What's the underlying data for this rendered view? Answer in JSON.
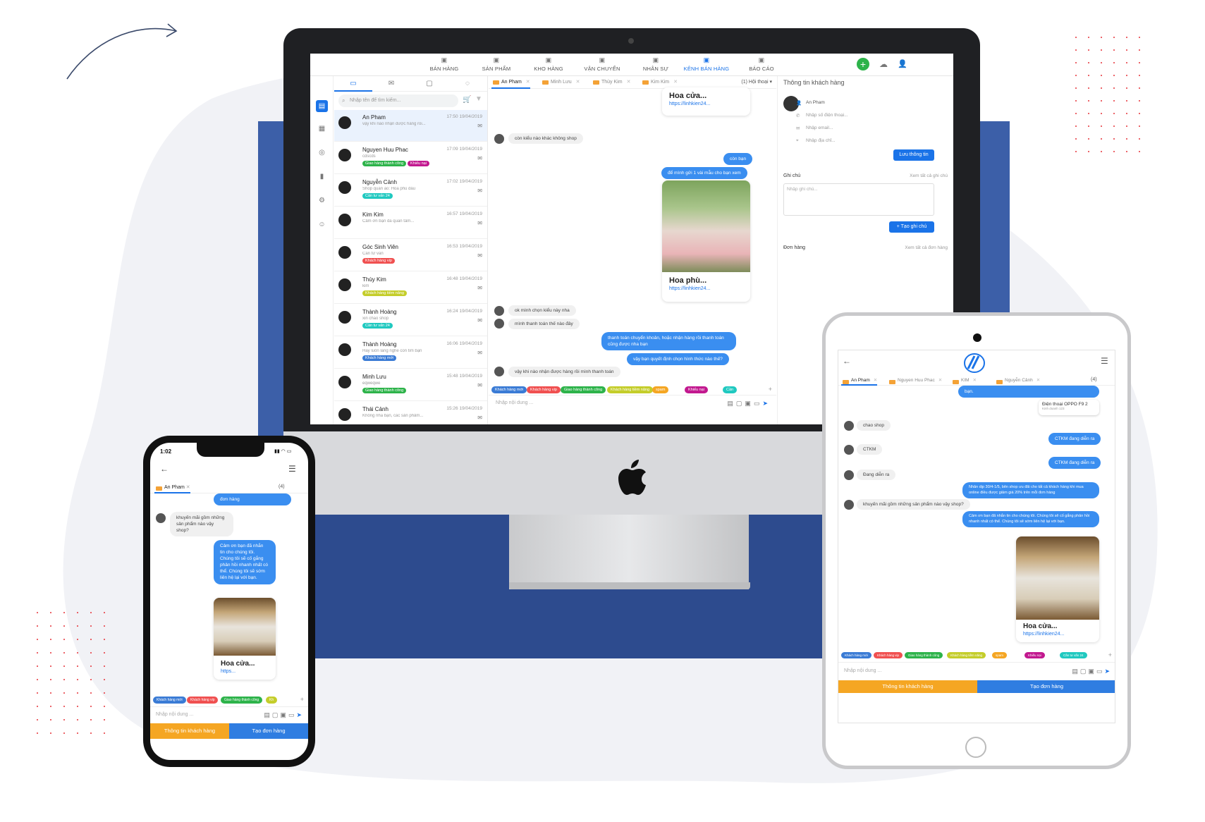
{
  "nav": {
    "items": [
      {
        "label": "BÁN HÀNG",
        "icon": "basket-icon"
      },
      {
        "label": "SẢN PHẨM",
        "icon": "store-icon"
      },
      {
        "label": "KHO HÀNG",
        "icon": "warehouse-icon"
      },
      {
        "label": "VẬN CHUYỂN",
        "icon": "truck-icon"
      },
      {
        "label": "NHÂN SỰ",
        "icon": "id-card-icon"
      },
      {
        "label": "KÊNH BÁN HÀNG",
        "icon": "globe-icon",
        "active": true
      },
      {
        "label": "BÁO CÁO",
        "icon": "report-icon"
      }
    ]
  },
  "search": {
    "placeholder": "Nhập tên để tìm kiếm..."
  },
  "conversations": [
    {
      "name": "An Pham",
      "time": "17:50 19/04/2019",
      "preview": "vậy khi nào nhận được hàng rồi...",
      "tag": "",
      "tag_color": ""
    },
    {
      "name": "Nguyen Huu Phac",
      "time": "17:09 19/04/2019",
      "preview": "cdscds",
      "tag": "Giao hàng thành công",
      "tag_color": "#2db34a",
      "tag2": "Khiếu nại"
    },
    {
      "name": "Nguyễn Cảnh",
      "time": "17:02 19/04/2019",
      "preview": "Shop quần áo: Hoa phù dâu",
      "tag": "Cần tư vấn 24",
      "tag_color": "#20c9c0"
    },
    {
      "name": "Kim Kim",
      "time": "16:57 19/04/2019",
      "preview": "Cảm ơn bạn đã quan tâm...",
      "tag": "",
      "tag_color": ""
    },
    {
      "name": "Góc Sinh Viên",
      "time": "16:53 19/04/2019",
      "preview": "Cần tư vấn",
      "tag": "Khách hàng vip",
      "tag_color": "#f05050"
    },
    {
      "name": "Thùy Kim",
      "time": "16:48 19/04/2019",
      "preview": "kim",
      "tag": "Khách hàng tiềm năng",
      "tag_color": "#c4cd2a"
    },
    {
      "name": "Thành Hoàng",
      "time": "16:24 19/04/2019",
      "preview": "xin chao shop",
      "tag": "Cần tư vấn 24",
      "tag_color": "#20c9c0"
    },
    {
      "name": "Thành Hoàng",
      "time": "16:06 19/04/2019",
      "preview": "Hãy luôn lắng nghe con tim bạn",
      "tag": "Khách hàng mới",
      "tag_color": "#3a7bd5"
    },
    {
      "name": "Minh Lưu",
      "time": "15:48 19/04/2019",
      "preview": "eqweqwe",
      "tag": "Giao hàng thành công",
      "tag_color": "#2db34a"
    },
    {
      "name": "Thái Cảnh",
      "time": "15:26 19/04/2019",
      "preview": "Không nha bạn, các sản phẩm...",
      "tag": "",
      "tag_color": ""
    }
  ],
  "chat_tabs": [
    "An Pham",
    "Minh Lưu",
    "Thùy Kim",
    "Kim Kim"
  ],
  "chat_tab_count": "(1) Hội thoại",
  "messages": {
    "card1_title": "Hoa cửa...",
    "card1_link": "https://linhkien24...",
    "m1": "còn kiểu nào khác không shop",
    "m2": "còn bạn",
    "m3": "để mình gửi 1 vài mẫu cho bạn xem",
    "card2_title": "Hoa phù...",
    "card2_link": "https://linhkien24...",
    "m4": "ok mình chọn kiểu này nha",
    "m5": "mình thanh toán thế nào đây",
    "m6": "thanh toán chuyển khoản, hoặc nhận hàng rồi thanh toán cũng được nha bạn",
    "m7": "vậy bạn quyết định chọn hình thức nào thế?",
    "m8": "vậy khi nào nhận được hàng rồi mình thanh toán"
  },
  "quick_tags": [
    {
      "label": "Khách hàng mới",
      "color": "#3a7bd5"
    },
    {
      "label": "Khách hàng vip",
      "color": "#f05050"
    },
    {
      "label": "Giao hàng thành công",
      "color": "#2db34a"
    },
    {
      "label": "Khách hàng tiềm năng",
      "color": "#c4cd2a"
    },
    {
      "label": "spam",
      "color": "#f5a623"
    },
    {
      "label": "Khiếu nại",
      "color": "#c2188f"
    },
    {
      "label": "Cần",
      "color": "#20c9c0"
    }
  ],
  "input_placeholder": "Nhập nội dung ...",
  "info": {
    "title": "Thông tin khách hàng",
    "name": "An Pham",
    "phone": "Nhập số điện thoại...",
    "email": "Nhập email...",
    "address": "Nhập địa chỉ...",
    "save": "Lưu thông tin",
    "note_title": "Ghi chú",
    "note_link": "Xem tất cả ghi chú",
    "note_placeholder": "Nhập ghi chú...",
    "note_btn": "+ Tạo ghi chú",
    "order_title": "Đơn hàng",
    "order_link": "Xem tất cả đơn hàng"
  },
  "phone": {
    "time": "1:02",
    "tab": "An Pham",
    "count": "(4)",
    "m0": "đơn hàng",
    "m1": "khuyến mãi gồm những sản phẩm nào vậy shop?",
    "m2": "Cảm ơn bạn đã nhắn tin cho chúng tôi. Chúng tôi sẽ cố gắng phản hồi nhanh nhất có thể. Chúng tôi sẽ sớm liên hệ lại với bạn.",
    "card_title": "Hoa cửa...",
    "card_link": "https...",
    "tags": [
      "Khách hàng mới",
      "Khách hàng vip",
      "Giao hàng thành công",
      "Kh"
    ],
    "input": "Nhập nội dung ...",
    "btn_info": "Thông tin khách hàng",
    "btn_order": "Tạo đơn hàng"
  },
  "tablet": {
    "tabs": [
      "An Pham",
      "Nguyen Huu Phac",
      "KIM",
      "Nguyễn Cảnh"
    ],
    "count": "(4)",
    "m0": "bạn.",
    "product": "Điện thoại OPPO F9 2",
    "product_sub": "Kinh doanh 123",
    "m1": "chao shop",
    "m2": "CTKM đang diễn ra",
    "m3": "CTKM",
    "m4": "CTKM đang diễn ra",
    "m5": "Đang diễn ra",
    "m6": "Nhân dịp 30/4-1/5, bên shop ưu đãi cho tất cả khách hàng khi mua online điều được giảm giá 20% trên mỗi đơn hàng",
    "m7": "khuyến mãi gồm những sản phẩm nào vậy shop?",
    "m8": "Cảm ơn bạn đã nhắn tin cho chúng tôi. Chúng tôi sẽ cố gắng phản hồi nhanh nhất có thể. Chúng tôi sẽ sớm liên hệ lại với bạn.",
    "card_title": "Hoa cửa...",
    "card_link": "https://linhkien24...",
    "tags": [
      "Khách hàng mới",
      "Khách hàng vip",
      "Giao hàng thành công",
      "Khách hàng tiềm năng",
      "spam",
      "Khiếu nại",
      "Cần tư vấn 24"
    ],
    "input": "Nhập nội dung ...",
    "btn_info": "Thông tin khách hàng",
    "btn_order": "Tạo đơn hàng"
  }
}
